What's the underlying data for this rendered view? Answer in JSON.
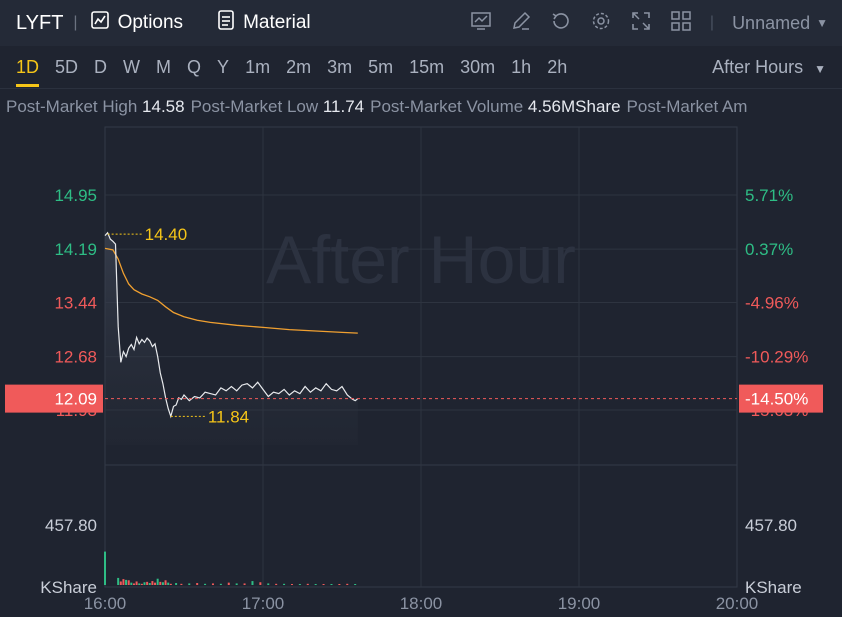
{
  "header": {
    "ticker": "LYFT",
    "options_label": "Options",
    "material_label": "Material",
    "layout_name": "Unnamed",
    "icons": [
      "chart-icon",
      "edit-icon",
      "refresh-icon",
      "settings-icon",
      "fullscreen-icon",
      "grid-icon",
      "chevron-down-icon"
    ]
  },
  "timeframes": [
    "1D",
    "5D",
    "D",
    "W",
    "M",
    "Q",
    "Y",
    "1m",
    "2m",
    "3m",
    "5m",
    "15m",
    "30m",
    "1h",
    "2h"
  ],
  "active_timeframe": "1D",
  "session_label": "After Hours",
  "stats": [
    {
      "label": "Post-Market High",
      "value": "14.58"
    },
    {
      "label": "Post-Market Low",
      "value": "11.74"
    },
    {
      "label": "Post-Market Volume",
      "value": "4.56MShare"
    },
    {
      "label": "Post-Market Am",
      "value": ""
    }
  ],
  "chart_data": {
    "type": "line",
    "watermark": "After Hour",
    "x_ticks": [
      "16:00",
      "17:00",
      "18:00",
      "19:00",
      "20:00"
    ],
    "x_range_minutes": [
      0,
      240
    ],
    "price_ticks_left": [
      "14.95",
      "14.19",
      "13.44",
      "12.68",
      "11.93"
    ],
    "price_tick_values": [
      14.95,
      14.19,
      13.44,
      12.68,
      11.93
    ],
    "pct_ticks_right": [
      "5.71%",
      "0.37%",
      "-4.96%",
      "-10.29%",
      "-15.63%"
    ],
    "current_price": "12.09",
    "current_pct": "-14.50%",
    "high_marker": {
      "label": "14.40",
      "value": 14.4,
      "t": 1
    },
    "low_marker": {
      "label": "11.84",
      "value": 11.84,
      "t": 25
    },
    "colors": {
      "up": "#2ebd85",
      "down": "#f05a5a",
      "price_line": "#e8eaed",
      "avg_line": "#f0a030",
      "marker": "#f5c518"
    },
    "price": [
      [
        0,
        14.38
      ],
      [
        1,
        14.42
      ],
      [
        2,
        14.33
      ],
      [
        3,
        14.3
      ],
      [
        4,
        14.26
      ],
      [
        5,
        13.1
      ],
      [
        6,
        12.6
      ],
      [
        7,
        12.75
      ],
      [
        8,
        12.68
      ],
      [
        9,
        12.8
      ],
      [
        10,
        12.85
      ],
      [
        11,
        12.78
      ],
      [
        12,
        12.95
      ],
      [
        13,
        12.86
      ],
      [
        14,
        12.92
      ],
      [
        15,
        12.88
      ],
      [
        16,
        12.94
      ],
      [
        17,
        12.9
      ],
      [
        18,
        12.82
      ],
      [
        19,
        12.86
      ],
      [
        20,
        12.68
      ],
      [
        21,
        12.45
      ],
      [
        22,
        12.3
      ],
      [
        23,
        12.1
      ],
      [
        24,
        11.95
      ],
      [
        25,
        11.84
      ],
      [
        26,
        11.98
      ],
      [
        27,
        12.0
      ],
      [
        28,
        12.1
      ],
      [
        29,
        12.08
      ],
      [
        30,
        12.14
      ],
      [
        32,
        12.06
      ],
      [
        34,
        12.12
      ],
      [
        36,
        12.1
      ],
      [
        38,
        12.18
      ],
      [
        40,
        12.16
      ],
      [
        42,
        12.14
      ],
      [
        44,
        12.24
      ],
      [
        46,
        12.2
      ],
      [
        48,
        12.26
      ],
      [
        50,
        12.2
      ],
      [
        52,
        12.28
      ],
      [
        54,
        12.3
      ],
      [
        56,
        12.24
      ],
      [
        58,
        12.32
      ],
      [
        60,
        12.22
      ],
      [
        62,
        12.12
      ],
      [
        64,
        12.18
      ],
      [
        66,
        12.16
      ],
      [
        68,
        12.22
      ],
      [
        70,
        12.14
      ],
      [
        72,
        12.2
      ],
      [
        74,
        12.16
      ],
      [
        76,
        12.26
      ],
      [
        78,
        12.18
      ],
      [
        80,
        12.24
      ],
      [
        82,
        12.2
      ],
      [
        84,
        12.3
      ],
      [
        86,
        12.22
      ],
      [
        88,
        12.2
      ],
      [
        90,
        12.26
      ],
      [
        92,
        12.14
      ],
      [
        94,
        12.08
      ],
      [
        95,
        12.06
      ],
      [
        96,
        12.09
      ]
    ],
    "avg": [
      [
        0,
        14.2
      ],
      [
        3,
        14.18
      ],
      [
        5,
        14.05
      ],
      [
        7,
        13.85
      ],
      [
        9,
        13.7
      ],
      [
        11,
        13.62
      ],
      [
        14,
        13.56
      ],
      [
        17,
        13.52
      ],
      [
        20,
        13.47
      ],
      [
        23,
        13.38
      ],
      [
        26,
        13.3
      ],
      [
        30,
        13.24
      ],
      [
        35,
        13.19
      ],
      [
        40,
        13.16
      ],
      [
        50,
        13.12
      ],
      [
        60,
        13.09
      ],
      [
        70,
        13.06
      ],
      [
        80,
        13.04
      ],
      [
        90,
        13.02
      ],
      [
        96,
        13.01
      ]
    ],
    "volume_axis_label": "457.80",
    "volume_unit": "KShare",
    "volume": [
      [
        0,
        850,
        1
      ],
      [
        5,
        180,
        1
      ],
      [
        6,
        90,
        0
      ],
      [
        7,
        150,
        0
      ],
      [
        8,
        130,
        1
      ],
      [
        9,
        120,
        0
      ],
      [
        10,
        60,
        1
      ],
      [
        11,
        40,
        0
      ],
      [
        12,
        90,
        0
      ],
      [
        13,
        40,
        1
      ],
      [
        14,
        30,
        0
      ],
      [
        15,
        70,
        1
      ],
      [
        16,
        80,
        0
      ],
      [
        17,
        50,
        1
      ],
      [
        18,
        100,
        0
      ],
      [
        19,
        60,
        0
      ],
      [
        20,
        160,
        1
      ],
      [
        21,
        80,
        0
      ],
      [
        22,
        70,
        1
      ],
      [
        23,
        120,
        0
      ],
      [
        24,
        60,
        1
      ],
      [
        25,
        30,
        0
      ],
      [
        27,
        50,
        1
      ],
      [
        29,
        30,
        0
      ],
      [
        32,
        40,
        1
      ],
      [
        35,
        50,
        0
      ],
      [
        38,
        30,
        1
      ],
      [
        41,
        40,
        0
      ],
      [
        44,
        30,
        1
      ],
      [
        47,
        60,
        0
      ],
      [
        50,
        40,
        1
      ],
      [
        53,
        40,
        0
      ],
      [
        56,
        100,
        1
      ],
      [
        59,
        70,
        0
      ],
      [
        62,
        40,
        1
      ],
      [
        65,
        30,
        0
      ],
      [
        68,
        30,
        1
      ],
      [
        71,
        20,
        0
      ],
      [
        74,
        20,
        1
      ],
      [
        77,
        30,
        0
      ],
      [
        80,
        20,
        1
      ],
      [
        83,
        20,
        0
      ],
      [
        86,
        20,
        1
      ],
      [
        89,
        20,
        0
      ],
      [
        92,
        30,
        0
      ],
      [
        95,
        20,
        1
      ]
    ]
  }
}
